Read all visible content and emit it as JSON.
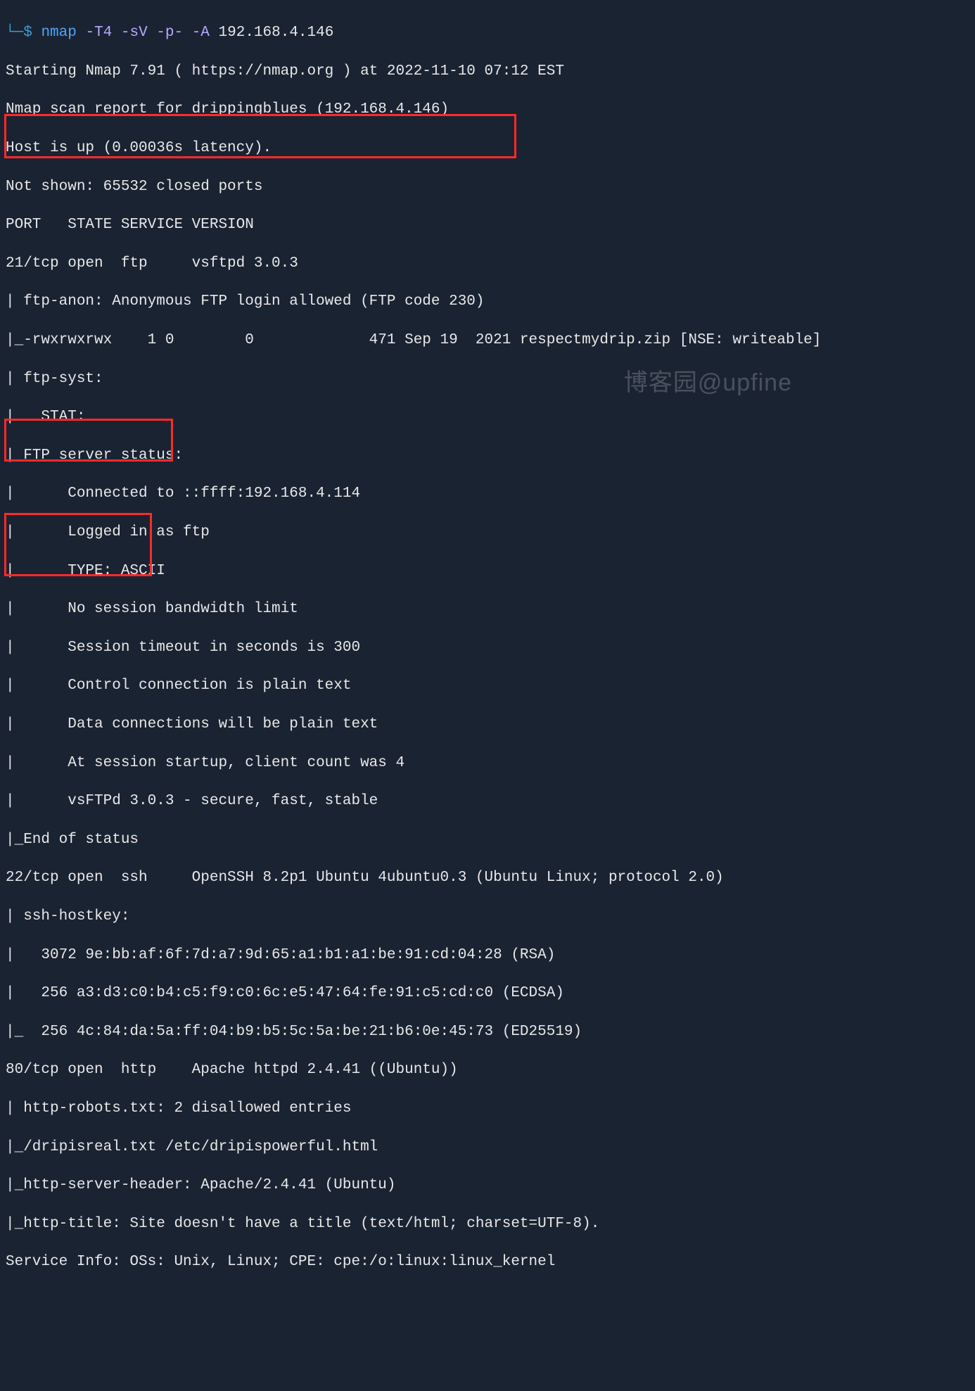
{
  "prompt": {
    "arrow": "└─",
    "dollar": "$",
    "command": "nmap",
    "flags": "-T4 -sV -p- -A",
    "target": "192.168.4.146"
  },
  "lines": {
    "l0": "Starting Nmap 7.91 ( https://nmap.org ) at 2022-11-10 07:12 EST",
    "l1": "Nmap scan report for drippingblues (192.168.4.146)",
    "l2": "Host is up (0.00036s latency).",
    "l3": "Not shown: 65532 closed ports",
    "l4": "PORT   STATE SERVICE VERSION",
    "l5": "21/tcp open  ftp     vsftpd 3.0.3",
    "l6": "| ftp-anon: Anonymous FTP login allowed (FTP code 230)",
    "l7": "|_-rwxrwxrwx    1 0        0             471 Sep 19  2021 respectmydrip.zip [NSE: writeable]",
    "l8": "| ftp-syst: ",
    "l9": "|   STAT: ",
    "l10": "| FTP server status:",
    "l11": "|      Connected to ::ffff:192.168.4.114",
    "l12": "|      Logged in as ftp",
    "l13": "|      TYPE: ASCII",
    "l14": "|      No session bandwidth limit",
    "l15": "|      Session timeout in seconds is 300",
    "l16": "|      Control connection is plain text",
    "l17": "|      Data connections will be plain text",
    "l18": "|      At session startup, client count was 4",
    "l19": "|      vsFTPd 3.0.3 - secure, fast, stable",
    "l20": "|_End of status",
    "l21": "22/tcp open  ssh     OpenSSH 8.2p1 Ubuntu 4ubuntu0.3 (Ubuntu Linux; protocol 2.0)",
    "l22": "| ssh-hostkey: ",
    "l23": "|   3072 9e:bb:af:6f:7d:a7:9d:65:a1:b1:a1:be:91:cd:04:28 (RSA)",
    "l24": "|   256 a3:d3:c0:b4:c5:f9:c0:6c:e5:47:64:fe:91:c5:cd:c0 (ECDSA)",
    "l25": "|_  256 4c:84:da:5a:ff:04:b9:b5:5c:5a:be:21:b6:0e:45:73 (ED25519)",
    "l26": "80/tcp open  http    Apache httpd 2.4.41 ((Ubuntu))",
    "l27": "| http-robots.txt: 2 disallowed entries ",
    "l28": "|_/dripisreal.txt /etc/dripispowerful.html",
    "l29": "|_http-server-header: Apache/2.4.41 (Ubuntu)",
    "l30": "|_http-title: Site doesn't have a title (text/html; charset=UTF-8).",
    "l31": "Service Info: OSs: Unix, Linux; CPE: cpe:/o:linux:linux_kernel"
  },
  "watermark": "博客园@upfine"
}
